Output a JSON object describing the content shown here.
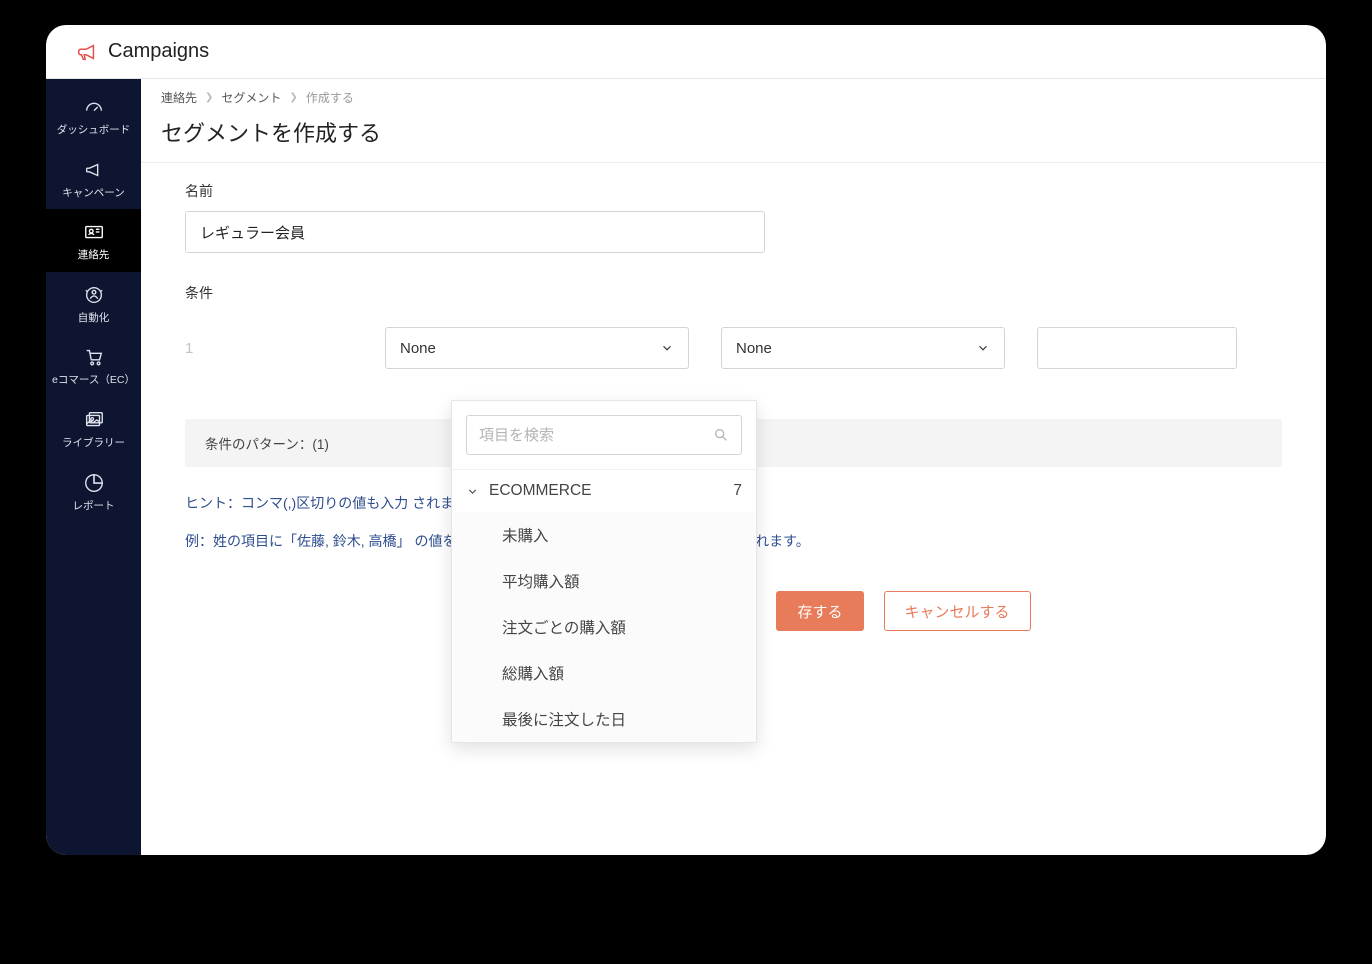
{
  "header": {
    "app_name": "Campaigns"
  },
  "sidebar": {
    "items": [
      {
        "label": "ダッシュボード"
      },
      {
        "label": "キャンペーン"
      },
      {
        "label": "連絡先"
      },
      {
        "label": "自動化"
      },
      {
        "label": "eコマース（EC）"
      },
      {
        "label": "ライブラリー"
      },
      {
        "label": "レポート"
      }
    ]
  },
  "breadcrumb": {
    "items": [
      "連絡先",
      "セグメント",
      "作成する"
    ]
  },
  "page": {
    "title": "セグメントを作成する"
  },
  "form": {
    "name_label": "名前",
    "name_value": "レギュラー会員",
    "conditions_label": "条件",
    "row_index": "1",
    "select1_value": "None",
    "select2_value": "None",
    "select3_value": "",
    "pattern_label": "条件のパターン：(1)"
  },
  "hints": {
    "line1": "ヒント：コンマ(,)区切りの値も入力                                                        されます。",
    "line2": "例：姓の項目に「佐藤, 鈴木, 高橋」                                                      の値を含む 鈴木)OR(姓 が次の値を含む 高橋)と解釈されます。"
  },
  "buttons": {
    "save": "存する",
    "cancel": "キャンセルする"
  },
  "dropdown": {
    "search_placeholder": "項目を検索",
    "category_title": "ECOMMERCE",
    "category_count": "7",
    "items": [
      "未購入",
      "平均購入額",
      "注文ごとの購入額",
      "総購入額",
      "最後に注文した日"
    ]
  }
}
